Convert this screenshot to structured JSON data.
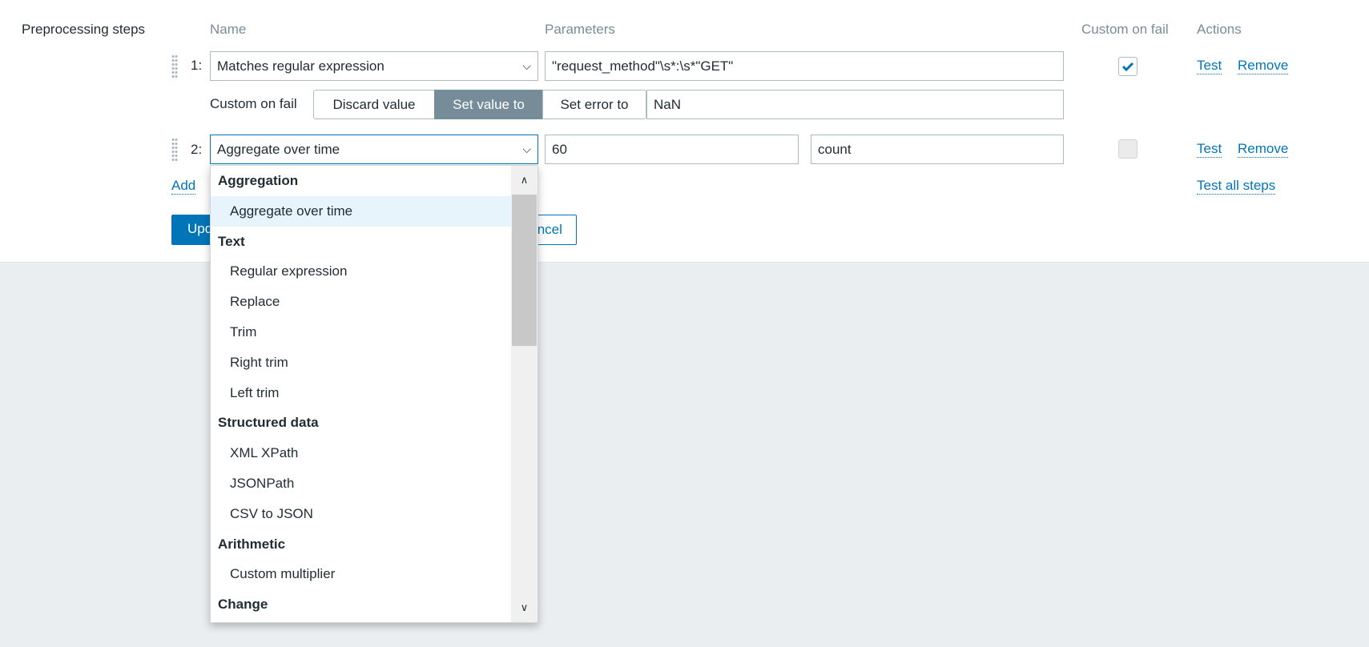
{
  "label": "Preprocessing steps",
  "headers": {
    "name": "Name",
    "parameters": "Parameters",
    "custom_on_fail": "Custom on fail",
    "actions": "Actions"
  },
  "steps": [
    {
      "num": "1:",
      "name": "Matches regular expression",
      "params": [
        "\"request_method\"\\s*:\\s*\"GET\""
      ],
      "custom_on_fail": true,
      "cof_label": "Custom on fail",
      "cof_options": [
        "Discard value",
        "Set value to",
        "Set error to"
      ],
      "cof_selected": "Set value to",
      "cof_value": "NaN"
    },
    {
      "num": "2:",
      "name": "Aggregate over time",
      "params": [
        "60",
        "count"
      ],
      "custom_on_fail": false
    }
  ],
  "actions": {
    "test": "Test",
    "remove": "Remove",
    "test_all": "Test all steps",
    "add": "Add"
  },
  "buttons": {
    "update": "Update",
    "cancel": "Cancel"
  },
  "dropdown": {
    "groups": [
      {
        "label": "Aggregation",
        "items": [
          "Aggregate over time"
        ]
      },
      {
        "label": "Text",
        "items": [
          "Regular expression",
          "Replace",
          "Trim",
          "Right trim",
          "Left trim"
        ]
      },
      {
        "label": "Structured data",
        "items": [
          "XML XPath",
          "JSONPath",
          "CSV to JSON"
        ]
      },
      {
        "label": "Arithmetic",
        "items": [
          "Custom multiplier"
        ]
      },
      {
        "label": "Change",
        "items": []
      }
    ],
    "highlighted": "Aggregate over time"
  },
  "colors": {
    "accent": "#0275b8",
    "selected_segment": "#768d99",
    "background": "#ebeef0"
  }
}
